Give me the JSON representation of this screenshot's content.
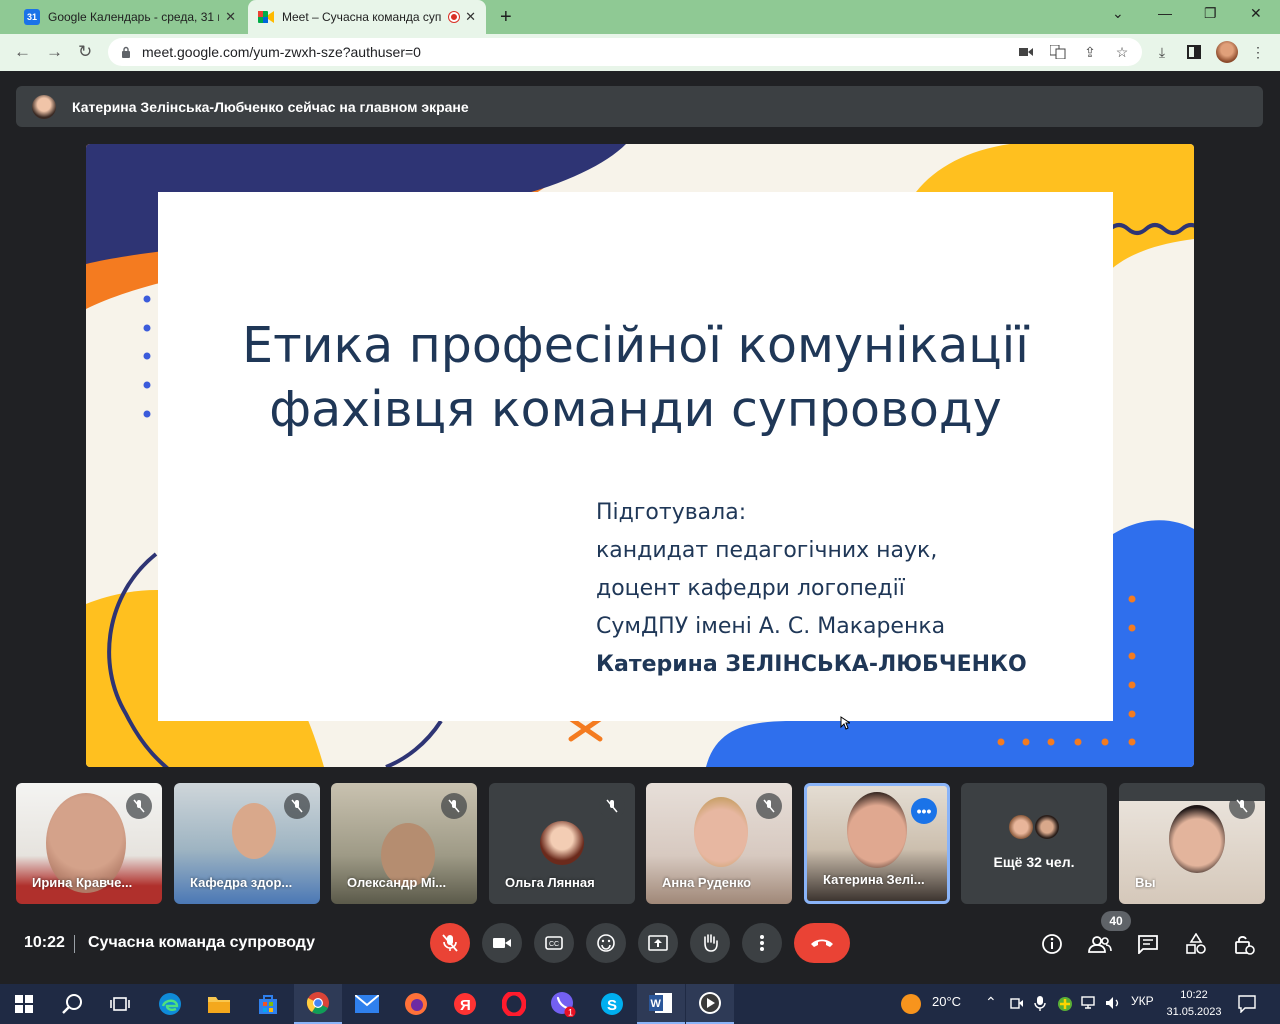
{
  "browser": {
    "tabs": [
      {
        "title": "Google Календарь - среда, 31 м",
        "favicon": "calendar-icon",
        "active": false
      },
      {
        "title": "Meet – Сучасна команда суп",
        "favicon": "meet-icon",
        "active": true
      }
    ],
    "calendar_date_label": "31",
    "url": "meet.google.com/yum-zwxh-sze?authuser=0"
  },
  "meet": {
    "presenting_banner": "Катерина Зелінська-Любченко сейчас на главном экране",
    "slide": {
      "title_line1": "Етика професійної комунікації",
      "title_line2": "фахівця команди супроводу",
      "sub_line1": "Підготувала:",
      "sub_line2": "кандидат педагогічних наук,",
      "sub_line3": "доцент кафедри логопедії",
      "sub_line4": "СумДПУ імені А. С. Макаренка",
      "sub_line5": "Катерина ЗЕЛІНСЬКА-ЛЮБЧЕНКО"
    },
    "participants": [
      {
        "name": "Ирина Кравче...",
        "muted": true
      },
      {
        "name": "Кафедра здор...",
        "muted": true
      },
      {
        "name": "Олександр Мі...",
        "muted": true
      },
      {
        "name": "Ольга Ляннaя",
        "muted": true
      },
      {
        "name": "Анна Руденко",
        "muted": true
      },
      {
        "name": "Катерина Зелі...",
        "muted": false,
        "speaking": true
      },
      {
        "name": "Ещё 32 чел.",
        "muted": false
      },
      {
        "name": "Вы",
        "muted": true
      }
    ],
    "time": "10:22",
    "meeting_title": "Сучасна команда супроводу",
    "people_count": "40"
  },
  "taskbar": {
    "weather": "20°C",
    "language": "УКР",
    "time": "10:22",
    "date": "31.05.2023",
    "viber_badge": "1"
  },
  "colors": {
    "tab_strip": "#8fc994",
    "meet_bg": "#202124",
    "end_call": "#ea4335",
    "slide_text": "#1f3757"
  }
}
